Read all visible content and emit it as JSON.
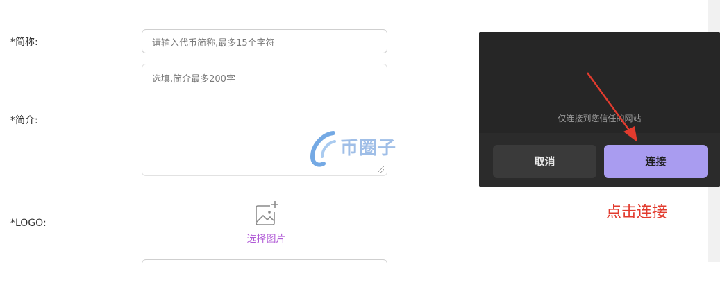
{
  "form": {
    "short_name_label": "*简称:",
    "short_name_placeholder": "请输入代币简称,最多15个字符",
    "intro_label": "*简介:",
    "intro_placeholder": "选填,简介最多200字",
    "logo_label": "*LOGO:",
    "logo_picker_text": "选择图片"
  },
  "dialog": {
    "trust_text": "仅连接到您信任的网站",
    "cancel_label": "取消",
    "connect_label": "连接"
  },
  "annotation": {
    "hint": "点击连接"
  },
  "watermark": {
    "text": "币圈子"
  },
  "colors": {
    "accent_purple": "#a99cf0",
    "link_purple": "#b05ad6",
    "annotation_red": "#e23b2e"
  }
}
